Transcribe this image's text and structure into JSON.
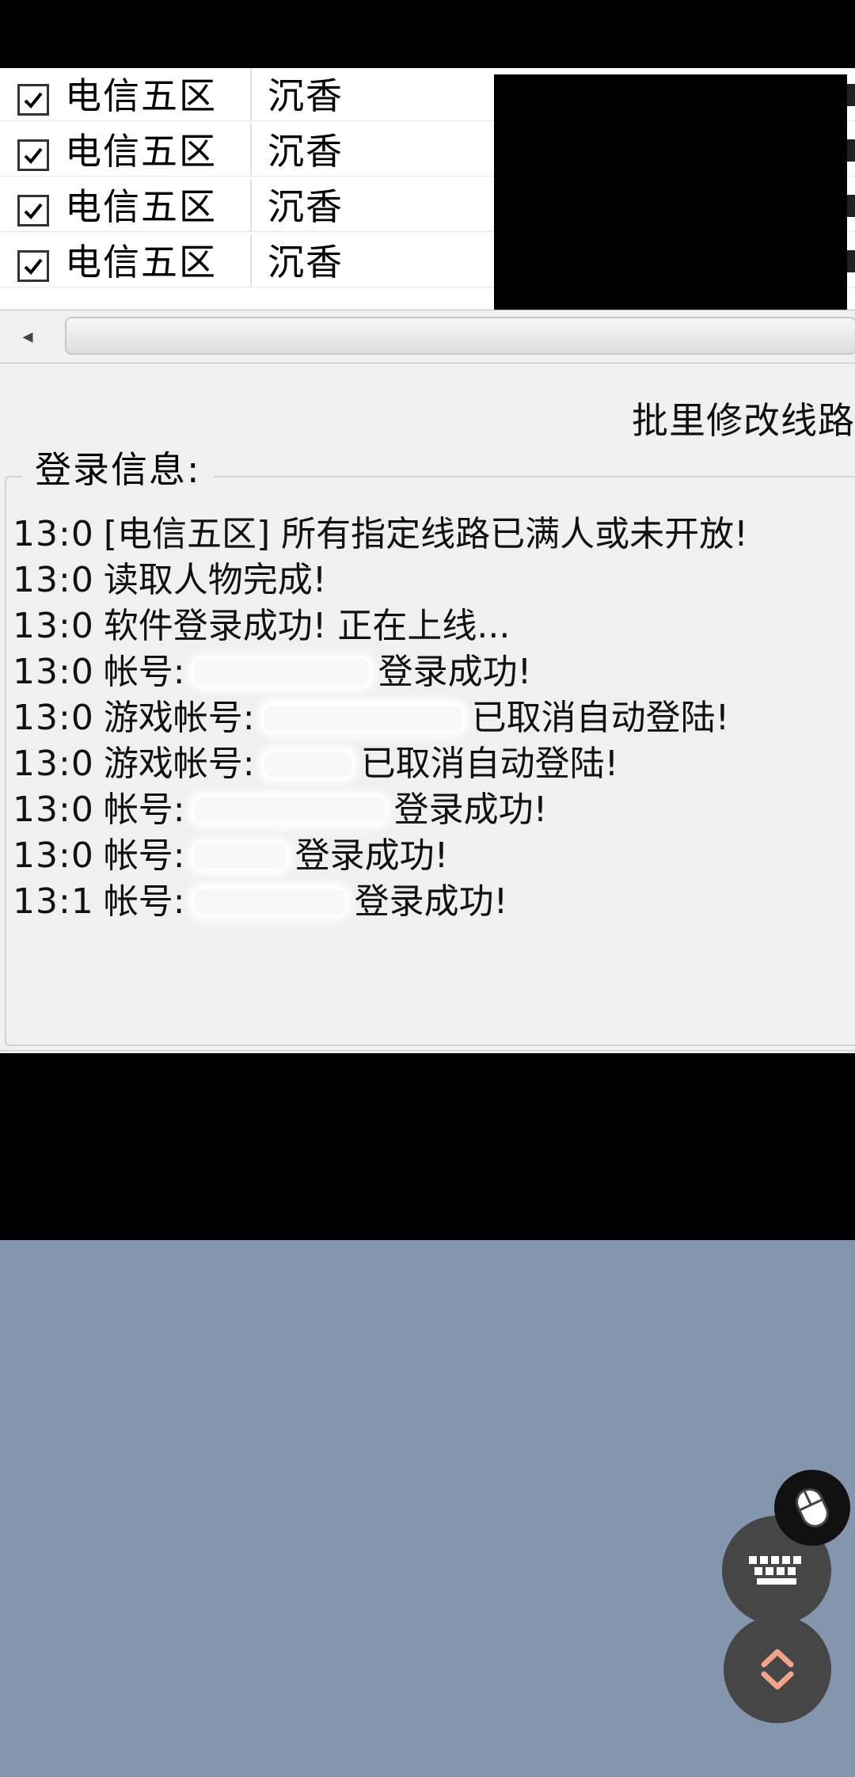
{
  "list": {
    "rows": [
      {
        "zone": "电信五区",
        "line": "沉香"
      },
      {
        "zone": "电信五区",
        "line": "沉香"
      },
      {
        "zone": "电信五区",
        "line": "沉香"
      },
      {
        "zone": "电信五区",
        "line": "沉香"
      }
    ]
  },
  "actions": {
    "batch_modify_label": "批里修改线路"
  },
  "login_group": {
    "legend": "登录信息:",
    "entries": [
      {
        "time": "13:0",
        "text": "[电信五区] 所有指定线路已满人或未开放!"
      },
      {
        "time": "13:0",
        "text": "读取人物完成!"
      },
      {
        "time": "13:0",
        "text": "软件登录成功! 正在上线..."
      },
      {
        "time": "13:0",
        "prefix": "帐号:",
        "suffix": "登录成功!"
      },
      {
        "time": "13:0",
        "prefix": "游戏帐号:",
        "suffix": "已取消自动登陆!"
      },
      {
        "time": "13:0",
        "prefix": "游戏帐号:",
        "suffix": "已取消自动登陆!"
      },
      {
        "time": "13:0",
        "prefix": "帐号:",
        "suffix": "登录成功!"
      },
      {
        "time": "13:0",
        "prefix": "帐号:",
        "suffix": "登录成功!"
      },
      {
        "time": "13:1",
        "prefix": "帐号:",
        "suffix": "登录成功!"
      }
    ]
  },
  "controls": {
    "mouse_icon": "mouse-icon",
    "keyboard_icon": "keyboard-icon",
    "scroll_icon": "chevrons-up-down-icon"
  },
  "colors": {
    "bottom_background": "#8396ae",
    "fab_background": "#464646",
    "scroll_chevron": "#f2a48a"
  }
}
